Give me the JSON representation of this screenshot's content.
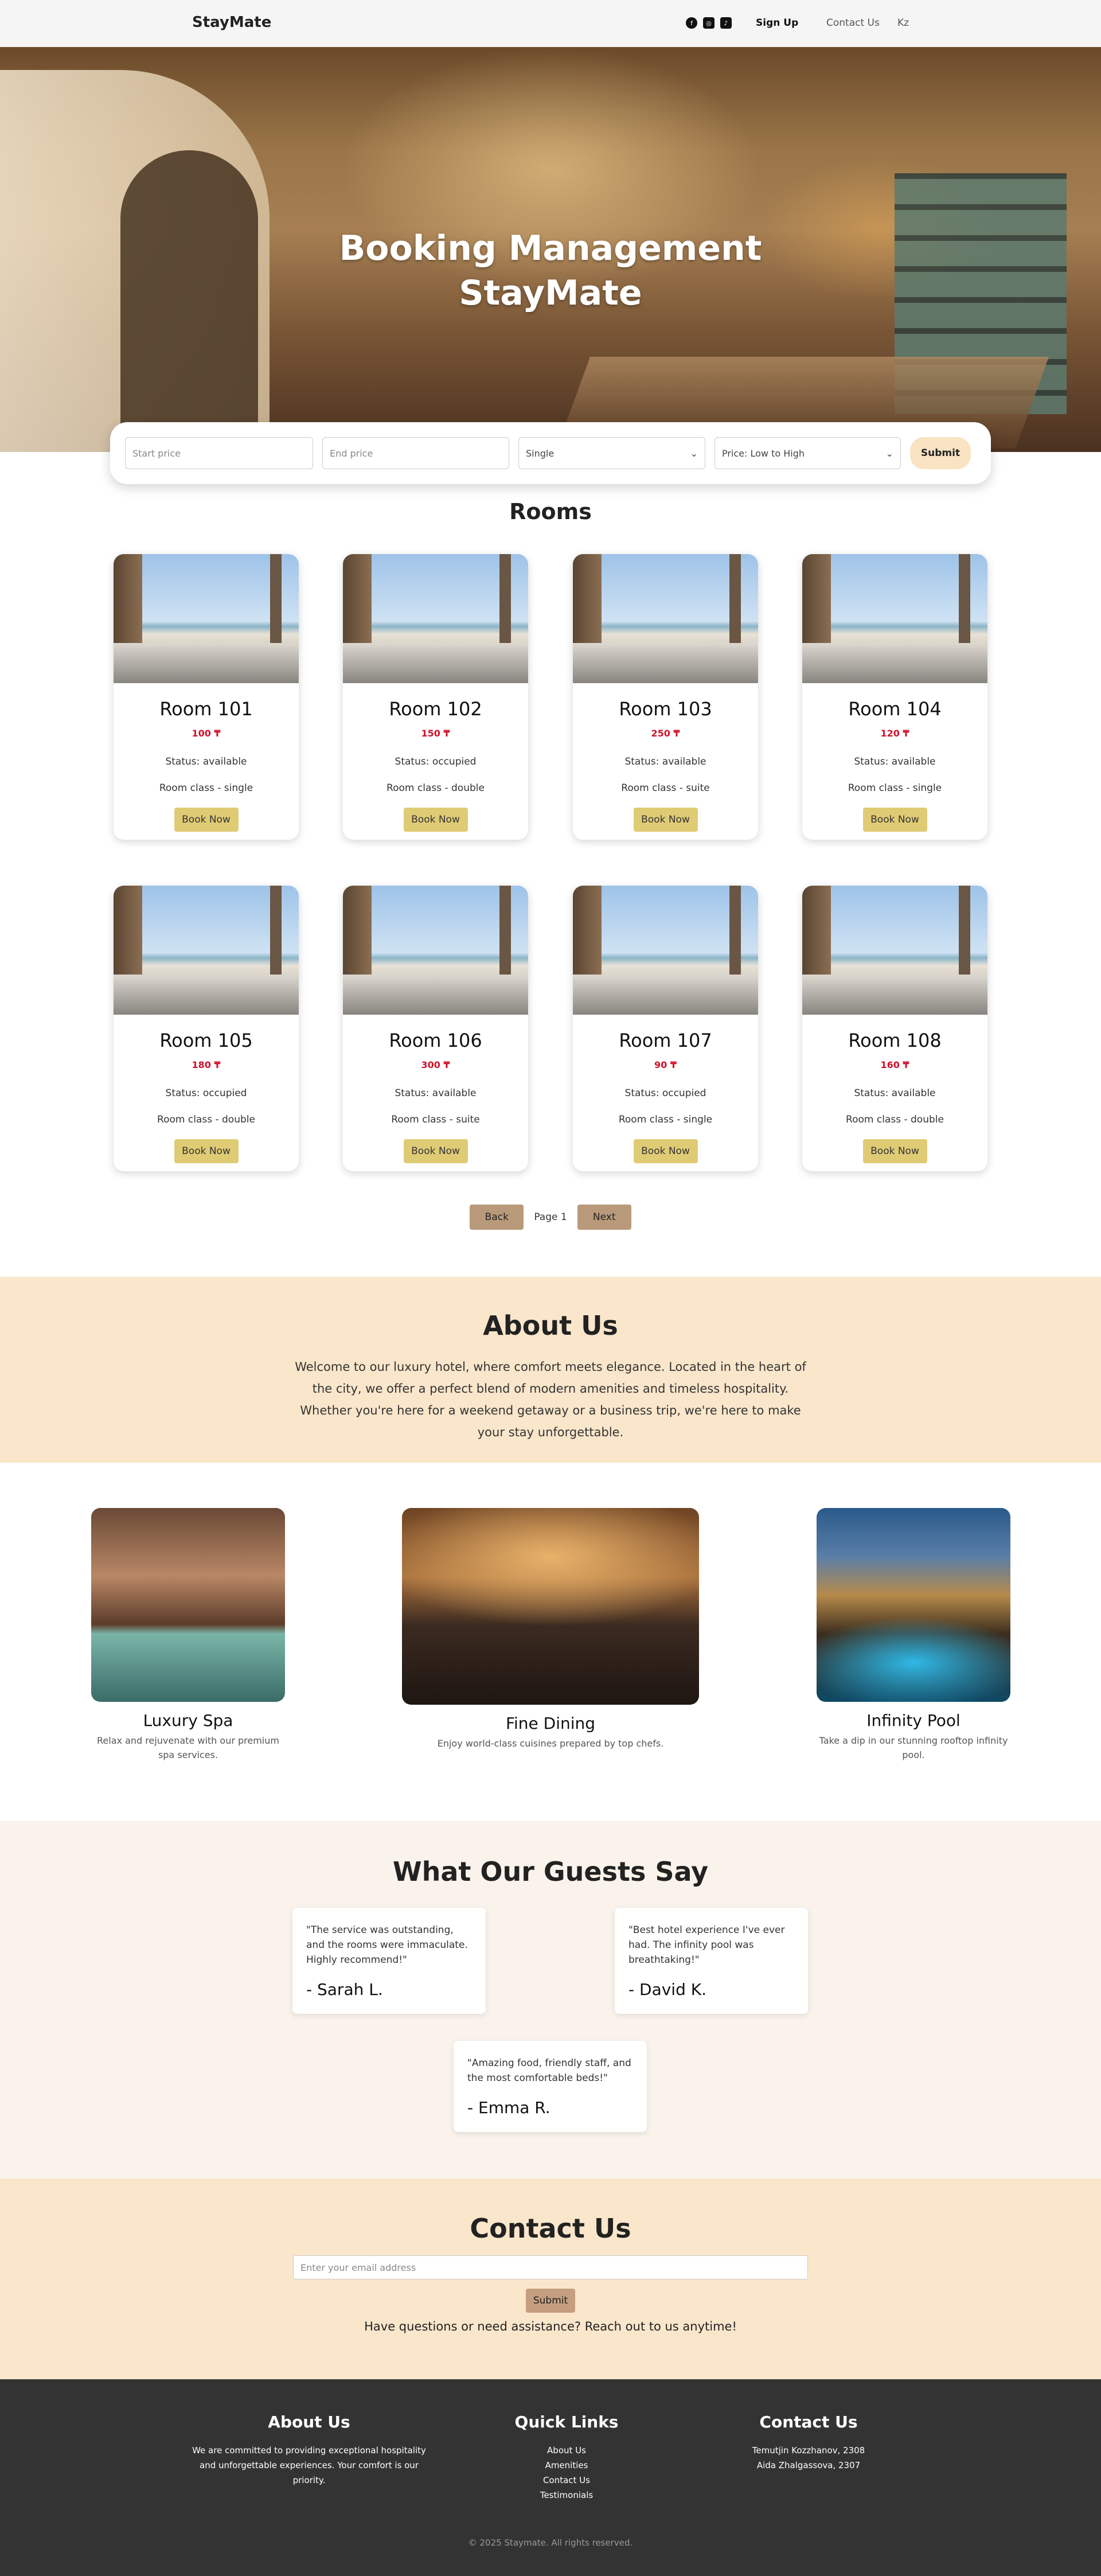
{
  "nav": {
    "brand": "StayMate",
    "social": [
      "facebook-icon",
      "instagram-icon",
      "tiktok-icon"
    ],
    "signup": "Sign Up",
    "contact": "Contact Us",
    "lang": "Kz"
  },
  "hero": {
    "line1": "Booking Management",
    "line2": "StayMate"
  },
  "filter": {
    "start_placeholder": "Start price",
    "end_placeholder": "End price",
    "room_type": "Single",
    "sort": "Price: Low to High",
    "submit": "Submit"
  },
  "rooms": {
    "title": "Rooms",
    "items": [
      {
        "name": "Room 101",
        "price": "100 ₸",
        "status": "Status: available",
        "class": "Room class - single",
        "book": "Book Now"
      },
      {
        "name": "Room 102",
        "price": "150 ₸",
        "status": "Status: occupied",
        "class": "Room class - double",
        "book": "Book Now"
      },
      {
        "name": "Room 103",
        "price": "250 ₸",
        "status": "Status: available",
        "class": "Room class - suite",
        "book": "Book Now"
      },
      {
        "name": "Room 104",
        "price": "120 ₸",
        "status": "Status: available",
        "class": "Room class - single",
        "book": "Book Now"
      },
      {
        "name": "Room 105",
        "price": "180 ₸",
        "status": "Status: occupied",
        "class": "Room class - double",
        "book": "Book Now"
      },
      {
        "name": "Room 106",
        "price": "300 ₸",
        "status": "Status: available",
        "class": "Room class - suite",
        "book": "Book Now"
      },
      {
        "name": "Room 107",
        "price": "90 ₸",
        "status": "Status: occupied",
        "class": "Room class - single",
        "book": "Book Now"
      },
      {
        "name": "Room 108",
        "price": "160 ₸",
        "status": "Status: available",
        "class": "Room class - double",
        "book": "Book Now"
      }
    ]
  },
  "pager": {
    "back": "Back",
    "label": "Page 1",
    "next": "Next"
  },
  "about": {
    "title": "About Us",
    "text": "Welcome to our luxury hotel, where comfort meets elegance. Located in the heart of the city, we offer a perfect blend of modern amenities and timeless hospitality. Whether you're here for a weekend getaway or a business trip, we're here to make your stay unforgettable."
  },
  "amenities": [
    {
      "title": "Luxury Spa",
      "text": "Relax and rejuvenate with our premium spa services."
    },
    {
      "title": "Fine Dining",
      "text": "Enjoy world-class cuisines prepared by top chefs."
    },
    {
      "title": "Infinity Pool",
      "text": "Take a dip in our stunning rooftop infinity pool."
    }
  ],
  "testimonials": {
    "title": "What Our Guests Say",
    "items": [
      {
        "quote": "\"The service was outstanding, and the rooms were immaculate. Highly recommend!\"",
        "author": "- Sarah L."
      },
      {
        "quote": "\"Best hotel experience I've ever had. The infinity pool was breathtaking!\"",
        "author": "- David K."
      },
      {
        "quote": "\"Amazing food, friendly staff, and the most comfortable beds!\"",
        "author": "- Emma R."
      }
    ]
  },
  "contact": {
    "title": "Contact Us",
    "placeholder": "Enter your email address",
    "submit": "Submit",
    "note": "Have questions or need assistance? Reach out to us anytime!"
  },
  "footer": {
    "about_title": "About Us",
    "about_text": "We are committed to providing exceptional hospitality and unforgettable experiences. Your comfort is our priority.",
    "links_title": "Quick Links",
    "links": [
      "About Us",
      "Amenities",
      "Contact Us",
      "Testimonials"
    ],
    "contact_title": "Contact Us",
    "address1": "Temutjin Kozzhanov, 2308",
    "address2": "Aida Zhalgassova, 2307",
    "copyright": "© 2025 Staymate. All rights reserved."
  }
}
